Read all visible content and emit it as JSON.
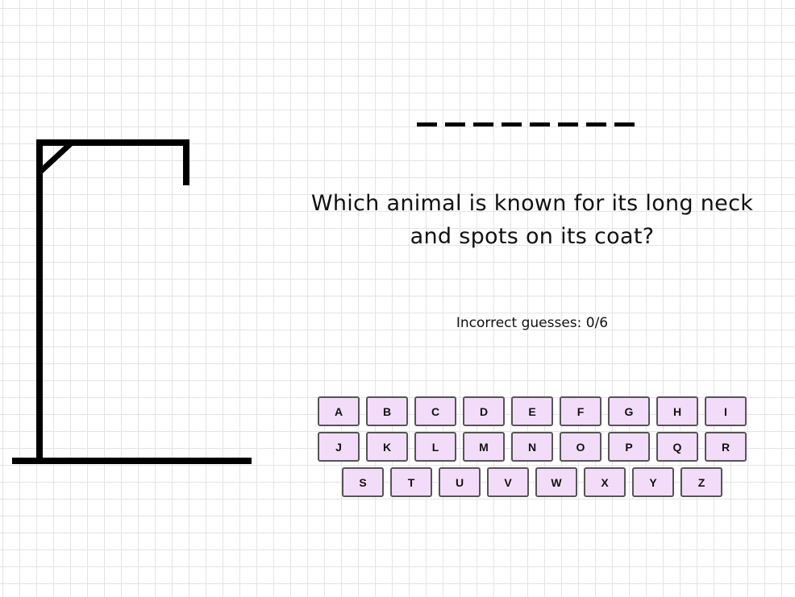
{
  "game": {
    "word_length": 8,
    "question": "Which animal is known for its long neck and spots on its coat?",
    "incorrect_guesses_text": "Incorrect guesses: 0/6",
    "incorrect_count": 0,
    "max_incorrect": 6
  },
  "keyboard": {
    "rows": [
      [
        "A",
        "B",
        "C",
        "D",
        "E",
        "F",
        "G",
        "H",
        "I"
      ],
      [
        "J",
        "K",
        "L",
        "M",
        "N",
        "O",
        "P",
        "Q",
        "R"
      ],
      [
        "S",
        "T",
        "U",
        "V",
        "W",
        "X",
        "Y",
        "Z"
      ]
    ]
  },
  "colors": {
    "key_background": "#f3dcf9",
    "key_border": "#555555",
    "gallows": "#000000",
    "grid_line": "#e4e4e4"
  }
}
